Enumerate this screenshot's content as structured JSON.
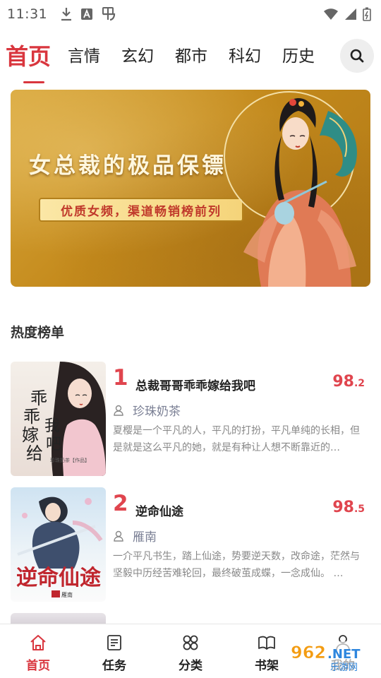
{
  "status_bar": {
    "time": "11:31"
  },
  "tabs": [
    {
      "label": "首页",
      "active": true
    },
    {
      "label": "言情",
      "active": false
    },
    {
      "label": "玄幻",
      "active": false
    },
    {
      "label": "都市",
      "active": false
    },
    {
      "label": "科幻",
      "active": false
    },
    {
      "label": "历史",
      "active": false
    }
  ],
  "search": {
    "icon": "search-icon"
  },
  "banner": {
    "title": "女总裁的极品保镖",
    "subtitle": "优质女频，渠道畅销榜前列"
  },
  "section": {
    "title": "热度榜单"
  },
  "rankings": [
    {
      "rank": "1",
      "title": "总裁哥哥乖乖嫁给我吧",
      "score_main": "98",
      "score_decimal": ".2",
      "author": "珍珠奶茶",
      "description": "夏樱是一个平凡的人，平凡的打扮，平凡单纯的长相，但是就是这么平凡的她，就是有种让人想不断靠近的…",
      "cover_text": "乖乖嫁给我吧",
      "cover_author": "珍珠奶茶【作品】"
    },
    {
      "rank": "2",
      "title": "逆命仙途",
      "score_main": "98",
      "score_decimal": ".5",
      "author": "雁南",
      "description": "一介平凡书生，踏上仙途，势要逆天数，改命途，茫然与坚毅中历经苦难轮回，最终破茧成蝶，一念成仙。 …",
      "cover_text": "逆命仙途",
      "cover_author": "雁南"
    }
  ],
  "bottom_nav": [
    {
      "label": "首页",
      "icon": "home-icon",
      "active": true
    },
    {
      "label": "任务",
      "icon": "task-icon",
      "active": false
    },
    {
      "label": "分类",
      "icon": "category-icon",
      "active": false
    },
    {
      "label": "书架",
      "icon": "bookshelf-icon",
      "active": false
    },
    {
      "label": "我的",
      "icon": "user-icon",
      "active": false
    }
  ],
  "watermark": {
    "text": "962.NET",
    "subtext": "乐游网"
  },
  "colors": {
    "accent": "#d9363e",
    "score": "#e0454e",
    "author": "#7a7f94"
  }
}
